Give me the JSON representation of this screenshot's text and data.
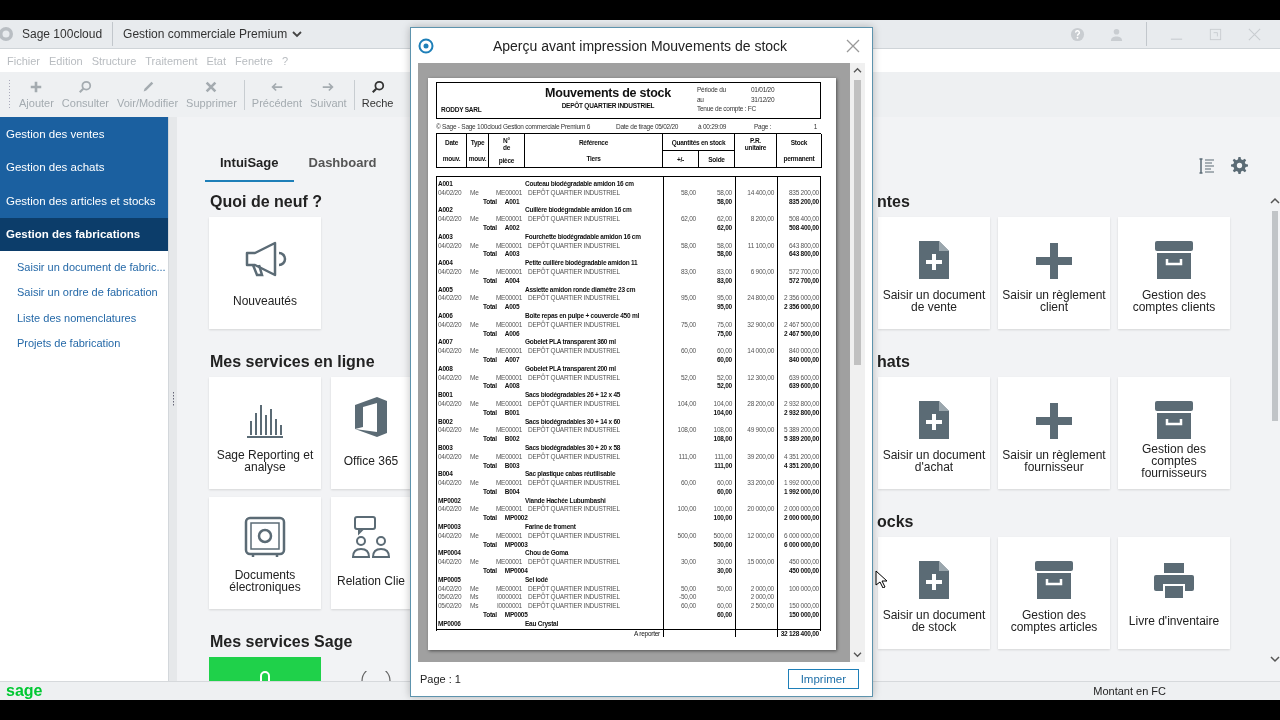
{
  "app_bar": {
    "product": "Sage 100cloud",
    "module": "Gestion commerciale Premium"
  },
  "menu": [
    "Fichier",
    "Edition",
    "Structure",
    "Traitement",
    "Etat",
    "Fenetre",
    "?"
  ],
  "toolbar": [
    [
      {
        "label": "Ajouter",
        "kind": "plus",
        "disabled": true
      },
      {
        "label": "Consulter",
        "kind": "search",
        "disabled": true
      },
      {
        "label": "Voir/Modifier",
        "kind": "pencil",
        "disabled": true
      },
      {
        "label": "Supprimer",
        "kind": "cross",
        "disabled": true
      }
    ],
    [
      {
        "label": "Précédent",
        "kind": "left",
        "disabled": true
      },
      {
        "label": "Suivant",
        "kind": "right",
        "disabled": true
      }
    ],
    [
      {
        "label": "Reche",
        "kind": "search",
        "disabled": false
      }
    ]
  ],
  "sidebar": {
    "modules": [
      {
        "label": "Gestion des ventes",
        "selected": false
      },
      {
        "label": "Gestion des achats",
        "selected": false
      },
      {
        "label": "Gestion des articles et stocks",
        "selected": false
      },
      {
        "label": "Gestion des fabrications",
        "selected": true
      }
    ],
    "links": [
      "Saisir un document de fabric...",
      "Saisir un ordre de fabrication",
      "Liste des nomenclatures",
      "Projets de fabrication"
    ]
  },
  "tabs": [
    {
      "label": "IntuiSage",
      "selected": true
    },
    {
      "label": "Dashboard",
      "selected": false
    }
  ],
  "left_sections": [
    {
      "title": "Quoi de neuf ?",
      "tiles": [
        {
          "label": "Nouveautés",
          "kind": "megaphone"
        }
      ]
    },
    {
      "title": "Mes services en ligne",
      "tiles": [
        {
          "label": "Sage Reporting et analyse",
          "kind": "bars"
        },
        {
          "label": "Office 365",
          "kind": "office"
        },
        {
          "label": "Documents électroniques",
          "kind": "safe"
        },
        {
          "label": "Relation Clie",
          "kind": "people"
        }
      ]
    },
    {
      "title": "Mes services Sage",
      "tiles": [
        {
          "kind": "green"
        },
        {
          "kind": "round"
        }
      ]
    }
  ],
  "right_sections": [
    {
      "title": "ntes",
      "tiles": [
        {
          "label": "Saisir un document de vente",
          "kind": "doc-plus"
        },
        {
          "label": "Saisir un règlement client",
          "kind": "plus"
        },
        {
          "label": "Gestion des comptes clients",
          "kind": "archive"
        }
      ]
    },
    {
      "title": "hats",
      "tiles": [
        {
          "label": "Saisir un document d'achat",
          "kind": "doc-plus"
        },
        {
          "label": "Saisir un règlement fournisseur",
          "kind": "plus"
        },
        {
          "label": "Gestion des comptes fournisseurs",
          "kind": "archive"
        }
      ]
    },
    {
      "title": "ocks",
      "tiles": [
        {
          "label": "Saisir un document de stock",
          "kind": "doc-plus"
        },
        {
          "label": "Gestion des comptes articles",
          "kind": "archive"
        },
        {
          "label": "Livre d'inventaire",
          "kind": "printer"
        }
      ]
    }
  ],
  "dialog": {
    "title": "Aperçu avant impression Mouvements de stock",
    "page_label": "Page : 1",
    "print_button": "Imprimer",
    "document": {
      "company": "RODDY SARL",
      "title": "Mouvements de stock",
      "depot": "DEPÔT QUARTIER INDUSTRIEL",
      "period": [
        {
          "label": "Période du",
          "value": "01/01/20"
        },
        {
          "label": "au",
          "value": "31/12/20"
        }
      ],
      "account": "Tenue de compte : FC",
      "info": [
        "© Sage - Sage 100cloud Gestion commerciale Premium 6",
        "Date de tirage 05/02/20",
        "à 00:29:09",
        "Page :",
        "1"
      ],
      "columns": {
        "date": [
          "Date",
          "mouv."
        ],
        "type": [
          "Type",
          "mouv."
        ],
        "piece": [
          "N° de",
          "pièce"
        ],
        "reference": [
          "Référence",
          "Tiers"
        ],
        "quantities": "Quantités en stock",
        "qty": "+/-",
        "solde": "Solde",
        "pr": "P.R. unitaire",
        "stock": [
          "Stock",
          "permanent"
        ]
      },
      "articles": [
        {
          "ref": "A001",
          "designation": "Couteau biodégradable amidon 16 cm",
          "moves": [
            {
              "date": "04/02/20",
              "type": "Me",
              "piece": "ME00001",
              "tiers": "DEPÔT QUARTIER INDUSTRIEL",
              "qty": "58,00",
              "solde": "58,00",
              "pr": "14 400,00",
              "stock": "835 200,00"
            }
          ],
          "total": {
            "label": "Total",
            "ref": "A001",
            "solde": "58,00",
            "stock": "835 200,00"
          }
        },
        {
          "ref": "A002",
          "designation": "Cuillère biodégradable amidon 16 cm",
          "moves": [
            {
              "date": "04/02/20",
              "type": "Me",
              "piece": "ME00001",
              "tiers": "DEPÔT QUARTIER INDUSTRIEL",
              "qty": "62,00",
              "solde": "62,00",
              "pr": "8 200,00",
              "stock": "508 400,00"
            }
          ],
          "total": {
            "label": "Total",
            "ref": "A002",
            "solde": "62,00",
            "stock": "508 400,00"
          }
        },
        {
          "ref": "A003",
          "designation": "Fourchette biodégradable amidon 16 cm",
          "moves": [
            {
              "date": "04/02/20",
              "type": "Me",
              "piece": "ME00001",
              "tiers": "DEPÔT QUARTIER INDUSTRIEL",
              "qty": "58,00",
              "solde": "58,00",
              "pr": "11 100,00",
              "stock": "643 800,00"
            }
          ],
          "total": {
            "label": "Total",
            "ref": "A003",
            "solde": "58,00",
            "stock": "643 800,00"
          }
        },
        {
          "ref": "A004",
          "designation": "Petite cuillère biodégradable amidon 11",
          "moves": [
            {
              "date": "04/02/20",
              "type": "Me",
              "piece": "ME00001",
              "tiers": "DEPÔT QUARTIER INDUSTRIEL",
              "qty": "83,00",
              "solde": "83,00",
              "pr": "6 900,00",
              "stock": "572 700,00"
            }
          ],
          "total": {
            "label": "Total",
            "ref": "A004",
            "solde": "83,00",
            "stock": "572 700,00"
          }
        },
        {
          "ref": "A005",
          "designation": "Assiette amidon ronde diamètre 23 cm",
          "moves": [
            {
              "date": "04/02/20",
              "type": "Me",
              "piece": "ME00001",
              "tiers": "DEPÔT QUARTIER INDUSTRIEL",
              "qty": "95,00",
              "solde": "95,00",
              "pr": "24 800,00",
              "stock": "2 356 000,00"
            }
          ],
          "total": {
            "label": "Total",
            "ref": "A005",
            "solde": "95,00",
            "stock": "2 356 000,00"
          }
        },
        {
          "ref": "A006",
          "designation": "Boîte repas en pulpe + couvercle 450 ml",
          "moves": [
            {
              "date": "04/02/20",
              "type": "Me",
              "piece": "ME00001",
              "tiers": "DEPÔT QUARTIER INDUSTRIEL",
              "qty": "75,00",
              "solde": "75,00",
              "pr": "32 900,00",
              "stock": "2 467 500,00"
            }
          ],
          "total": {
            "label": "Total",
            "ref": "A006",
            "solde": "75,00",
            "stock": "2 467 500,00"
          }
        },
        {
          "ref": "A007",
          "designation": "Gobelet PLA transparent 360 ml",
          "moves": [
            {
              "date": "04/02/20",
              "type": "Me",
              "piece": "ME00001",
              "tiers": "DEPÔT QUARTIER INDUSTRIEL",
              "qty": "60,00",
              "solde": "60,00",
              "pr": "14 000,00",
              "stock": "840 000,00"
            }
          ],
          "total": {
            "label": "Total",
            "ref": "A007",
            "solde": "60,00",
            "stock": "840 000,00"
          }
        },
        {
          "ref": "A008",
          "designation": "Gobelet PLA transparent 200 ml",
          "moves": [
            {
              "date": "04/02/20",
              "type": "Me",
              "piece": "ME00001",
              "tiers": "DEPÔT QUARTIER INDUSTRIEL",
              "qty": "52,00",
              "solde": "52,00",
              "pr": "12 300,00",
              "stock": "639 600,00"
            }
          ],
          "total": {
            "label": "Total",
            "ref": "A008",
            "solde": "52,00",
            "stock": "639 600,00"
          }
        },
        {
          "ref": "B001",
          "designation": "Sacs biodégradables 26 + 12 x 45",
          "moves": [
            {
              "date": "04/02/20",
              "type": "Me",
              "piece": "ME00001",
              "tiers": "DEPÔT QUARTIER INDUSTRIEL",
              "qty": "104,00",
              "solde": "104,00",
              "pr": "28 200,00",
              "stock": "2 932 800,00"
            }
          ],
          "total": {
            "label": "Total",
            "ref": "B001",
            "solde": "104,00",
            "stock": "2 932 800,00"
          }
        },
        {
          "ref": "B002",
          "designation": "Sacs biodégradables 30 + 14 x 60",
          "moves": [
            {
              "date": "04/02/20",
              "type": "Me",
              "piece": "ME00001",
              "tiers": "DEPÔT QUARTIER INDUSTRIEL",
              "qty": "108,00",
              "solde": "108,00",
              "pr": "49 900,00",
              "stock": "5 389 200,00"
            }
          ],
          "total": {
            "label": "Total",
            "ref": "B002",
            "solde": "108,00",
            "stock": "5 389 200,00"
          }
        },
        {
          "ref": "B003",
          "designation": "Sacs biodégradables 30 + 20 x 58",
          "moves": [
            {
              "date": "04/02/20",
              "type": "Me",
              "piece": "ME00001",
              "tiers": "DEPÔT QUARTIER INDUSTRIEL",
              "qty": "111,00",
              "solde": "111,00",
              "pr": "39 200,00",
              "stock": "4 351 200,00"
            }
          ],
          "total": {
            "label": "Total",
            "ref": "B003",
            "solde": "111,00",
            "stock": "4 351 200,00"
          }
        },
        {
          "ref": "B004",
          "designation": "Sac plastique cabas réutilisable",
          "moves": [
            {
              "date": "04/02/20",
              "type": "Me",
              "piece": "ME00001",
              "tiers": "DEPÔT QUARTIER INDUSTRIEL",
              "qty": "60,00",
              "solde": "60,00",
              "pr": "33 200,00",
              "stock": "1 992 000,00"
            }
          ],
          "total": {
            "label": "Total",
            "ref": "B004",
            "solde": "60,00",
            "stock": "1 992 000,00"
          }
        },
        {
          "ref": "MP0002",
          "designation": "Viande Hachée Lubumbashi",
          "moves": [
            {
              "date": "04/02/20",
              "type": "Me",
              "piece": "ME00001",
              "tiers": "DEPÔT QUARTIER INDUSTRIEL",
              "qty": "100,00",
              "solde": "100,00",
              "pr": "20 000,00",
              "stock": "2 000 000,00"
            }
          ],
          "total": {
            "label": "Total",
            "ref": "MP0002",
            "solde": "100,00",
            "stock": "2 000 000,00"
          }
        },
        {
          "ref": "MP0003",
          "designation": "Farine de froment",
          "moves": [
            {
              "date": "04/02/20",
              "type": "Me",
              "piece": "ME00001",
              "tiers": "DEPÔT QUARTIER INDUSTRIEL",
              "qty": "500,00",
              "solde": "500,00",
              "pr": "12 000,00",
              "stock": "6 000 000,00"
            }
          ],
          "total": {
            "label": "Total",
            "ref": "MP0003",
            "solde": "500,00",
            "stock": "6 000 000,00"
          }
        },
        {
          "ref": "MP0004",
          "designation": "Chou de Goma",
          "moves": [
            {
              "date": "04/02/20",
              "type": "Me",
              "piece": "ME00001",
              "tiers": "DEPÔT QUARTIER INDUSTRIEL",
              "qty": "30,00",
              "solde": "30,00",
              "pr": "15 000,00",
              "stock": "450 000,00"
            }
          ],
          "total": {
            "label": "Total",
            "ref": "MP0004",
            "solde": "30,00",
            "stock": "450 000,00"
          }
        },
        {
          "ref": "MP0005",
          "designation": "Sel iodé",
          "moves": [
            {
              "date": "04/02/20",
              "type": "Me",
              "piece": "ME00001",
              "tiers": "DEPÔT QUARTIER INDUSTRIEL",
              "qty": "50,00",
              "solde": "50,00",
              "pr": "2 000,00",
              "stock": "100 000,00"
            },
            {
              "date": "05/02/20",
              "type": "Ms",
              "piece": "I0000001",
              "tiers": "DEPÔT QUARTIER INDUSTRIEL",
              "qty": "-50,00",
              "pr": "2 000,00"
            },
            {
              "date": "05/02/20",
              "type": "Ms",
              "piece": "I0000001",
              "tiers": "DEPÔT QUARTIER INDUSTRIEL",
              "qty": "60,00",
              "solde": "60,00",
              "pr": "2 500,00",
              "stock": "150 000,00"
            }
          ],
          "total": {
            "label": "Total",
            "ref": "MP0005",
            "solde": "60,00",
            "stock": "150 000,00"
          }
        },
        {
          "ref": "MP0006",
          "designation": "Eau Crystal"
        }
      ],
      "carry": {
        "label": "A reporter",
        "stock": "32 128 400,00"
      }
    }
  },
  "status_bar": {
    "logo": "sage",
    "currency": "Montant en FC"
  }
}
